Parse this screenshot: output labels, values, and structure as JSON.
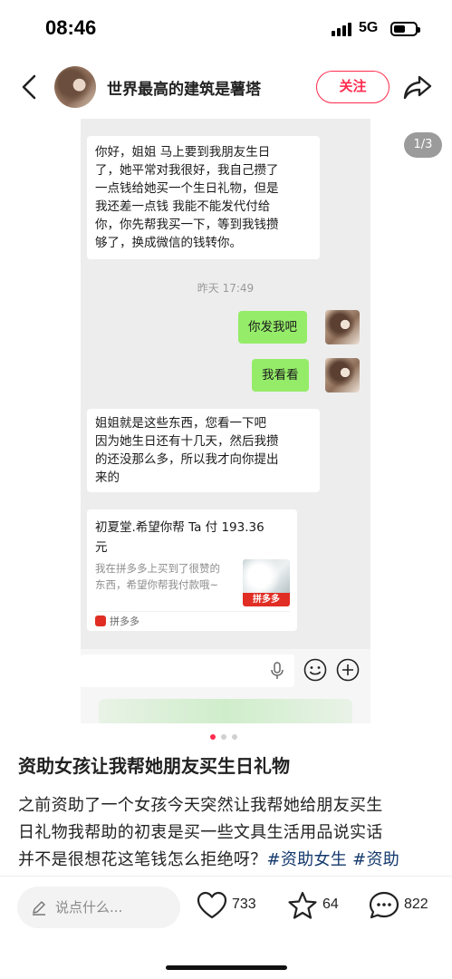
{
  "status_bar": {
    "time": "08:46",
    "network": "5G"
  },
  "header": {
    "author_name": "世界最高的建筑是薯塔",
    "follow_label": "关注"
  },
  "image": {
    "page_indicator": "1/3",
    "chat": {
      "msg1_lines": [
        "你好，姐姐   马上要到我朋友生日",
        "了，她平常对我很好，我自己攒了",
        "一点钱给她买一个生日礼物，但是",
        "我还差一点钱  我能不能发代付给",
        "你，你先帮我买一下，等到我钱攒",
        "够了，换成微信的钱转你。"
      ],
      "timestamp": "昨天 17:49",
      "msg2": "你发我吧",
      "msg3": "我看看",
      "msg4_lines": [
        "姐姐就是这些东西，您看一下吧",
        "因为她生日还有十几天，然后我攒",
        "的还没那么多，所以我才向你提出",
        "来的"
      ],
      "card": {
        "title_lines": [
          "初夏堂.希望你帮 Ta 付 193.36",
          "元"
        ],
        "desc_lines": [
          "我在拼多多上买到了很赞的",
          "东西，希望你帮我付款哦~"
        ],
        "thumb_label": "拼多多",
        "source": "拼多多"
      }
    },
    "carousel": {
      "total": 3,
      "current": 1
    }
  },
  "post": {
    "title": "资助女孩让我帮她朋友买生日礼物",
    "body_lines": [
      "之前资助了一个女孩今天突然让我帮她给朋友买生",
      "日礼物我帮助的初衷是买一些文具生活用品说实话",
      "并不是很想花这笔钱怎么拒绝呀？"
    ],
    "hashtags": [
      "#资助女生",
      "#资助"
    ]
  },
  "bottom_bar": {
    "comment_placeholder": "说点什么...",
    "likes": "733",
    "stars": "64",
    "comments": "822"
  },
  "colors": {
    "accent": "#ff2a4d",
    "wechat_green": "#95ec69",
    "hashtag": "#13386c"
  }
}
